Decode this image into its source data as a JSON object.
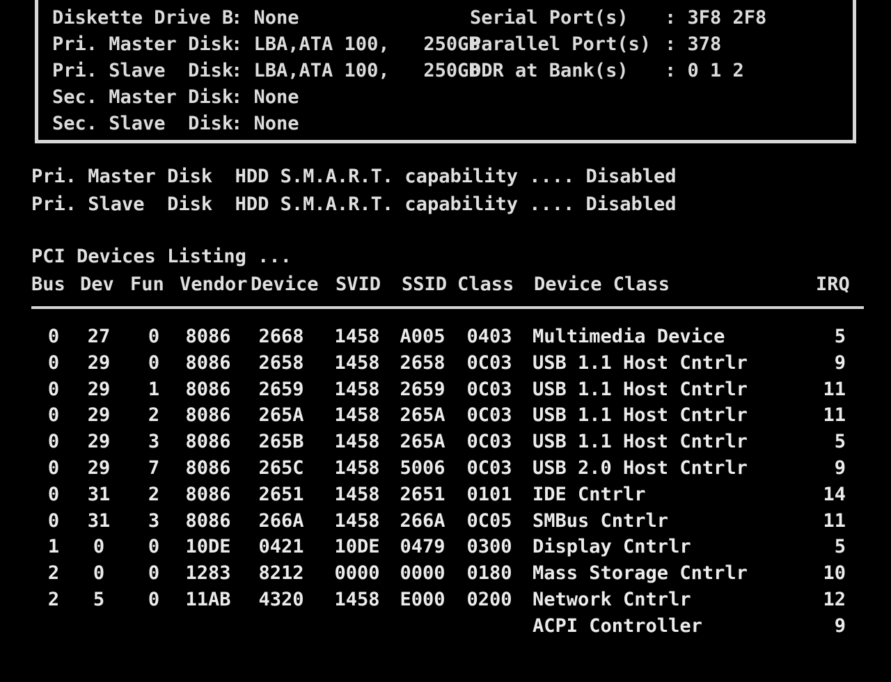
{
  "system_info": {
    "left": [
      {
        "label": "Diskette Drive B",
        "value": ": None"
      },
      {
        "label": "Pri. Master Disk",
        "value": ": LBA,ATA 100,   250GB"
      },
      {
        "label": "Pri. Slave  Disk",
        "value": ": LBA,ATA 100,   250GB"
      },
      {
        "label": "Sec. Master Disk",
        "value": ": None"
      },
      {
        "label": "Sec. Slave  Disk",
        "value": ": None"
      }
    ],
    "right": [
      {
        "label": "Serial Port(s)",
        "value": ": 3F8 2F8"
      },
      {
        "label": "Parallel Port(s)",
        "value": ": 378"
      },
      {
        "label": "DDR at Bank(s)",
        "value": ": 0 1 2"
      }
    ]
  },
  "smart": [
    "Pri. Master Disk  HDD S.M.A.R.T. capability .... Disabled",
    "Pri. Slave  Disk  HDD S.M.A.R.T. capability .... Disabled"
  ],
  "pci": {
    "title": "PCI Devices Listing ...",
    "headers": {
      "bus": "Bus",
      "dev": "Dev",
      "fun": "Fun",
      "vendor": "Vendor",
      "device": "Device",
      "svid": "SVID",
      "ssid": "SSID",
      "class": "Class",
      "device_class": "Device Class",
      "irq": "IRQ"
    },
    "rows": [
      {
        "bus": "0",
        "dev": "27",
        "fun": "0",
        "vendor": "8086",
        "device": "2668",
        "svid": "1458",
        "ssid": "A005",
        "class": "0403",
        "device_class": "Multimedia Device",
        "irq": "5"
      },
      {
        "bus": "0",
        "dev": "29",
        "fun": "0",
        "vendor": "8086",
        "device": "2658",
        "svid": "1458",
        "ssid": "2658",
        "class": "0C03",
        "device_class": "USB 1.1 Host Cntrlr",
        "irq": "9"
      },
      {
        "bus": "0",
        "dev": "29",
        "fun": "1",
        "vendor": "8086",
        "device": "2659",
        "svid": "1458",
        "ssid": "2659",
        "class": "0C03",
        "device_class": "USB 1.1 Host Cntrlr",
        "irq": "11"
      },
      {
        "bus": "0",
        "dev": "29",
        "fun": "2",
        "vendor": "8086",
        "device": "265A",
        "svid": "1458",
        "ssid": "265A",
        "class": "0C03",
        "device_class": "USB 1.1 Host Cntrlr",
        "irq": "11"
      },
      {
        "bus": "0",
        "dev": "29",
        "fun": "3",
        "vendor": "8086",
        "device": "265B",
        "svid": "1458",
        "ssid": "265A",
        "class": "0C03",
        "device_class": "USB 1.1 Host Cntrlr",
        "irq": "5"
      },
      {
        "bus": "0",
        "dev": "29",
        "fun": "7",
        "vendor": "8086",
        "device": "265C",
        "svid": "1458",
        "ssid": "5006",
        "class": "0C03",
        "device_class": "USB 2.0 Host Cntrlr",
        "irq": "9"
      },
      {
        "bus": "0",
        "dev": "31",
        "fun": "2",
        "vendor": "8086",
        "device": "2651",
        "svid": "1458",
        "ssid": "2651",
        "class": "0101",
        "device_class": "IDE Cntrlr",
        "irq": "14"
      },
      {
        "bus": "0",
        "dev": "31",
        "fun": "3",
        "vendor": "8086",
        "device": "266A",
        "svid": "1458",
        "ssid": "266A",
        "class": "0C05",
        "device_class": "SMBus Cntrlr",
        "irq": "11"
      },
      {
        "bus": "1",
        "dev": "0",
        "fun": "0",
        "vendor": "10DE",
        "device": "0421",
        "svid": "10DE",
        "ssid": "0479",
        "class": "0300",
        "device_class": "Display Cntrlr",
        "irq": "5"
      },
      {
        "bus": "2",
        "dev": "0",
        "fun": "0",
        "vendor": "1283",
        "device": "8212",
        "svid": "0000",
        "ssid": "0000",
        "class": "0180",
        "device_class": "Mass Storage Cntrlr",
        "irq": "10"
      },
      {
        "bus": "2",
        "dev": "5",
        "fun": "0",
        "vendor": "11AB",
        "device": "4320",
        "svid": "1458",
        "ssid": "E000",
        "class": "0200",
        "device_class": "Network Cntrlr",
        "irq": "12"
      },
      {
        "bus": "",
        "dev": "",
        "fun": "",
        "vendor": "",
        "device": "",
        "svid": "",
        "ssid": "",
        "class": "",
        "device_class": "ACPI Controller",
        "irq": "9"
      }
    ]
  }
}
